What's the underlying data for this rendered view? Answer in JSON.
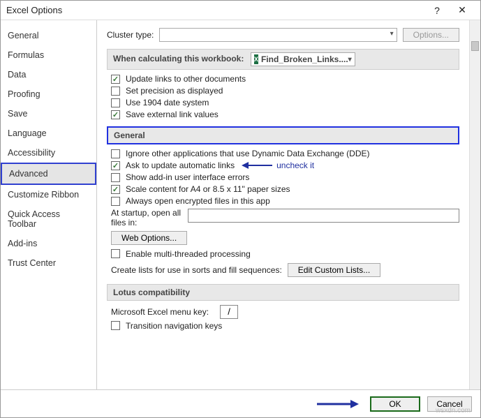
{
  "title": "Excel Options",
  "help_glyph": "?",
  "close_glyph": "✕",
  "sidebar": {
    "items": [
      {
        "label": "General"
      },
      {
        "label": "Formulas"
      },
      {
        "label": "Data"
      },
      {
        "label": "Proofing"
      },
      {
        "label": "Save"
      },
      {
        "label": "Language"
      },
      {
        "label": "Accessibility"
      },
      {
        "label": "Advanced"
      },
      {
        "label": "Customize Ribbon"
      },
      {
        "label": "Quick Access Toolbar"
      },
      {
        "label": "Add-ins"
      },
      {
        "label": "Trust Center"
      }
    ],
    "selected_index": 7
  },
  "cluster": {
    "label": "Cluster type:",
    "value": "",
    "options_btn": "Options..."
  },
  "calc_band": {
    "label": "When calculating this workbook:",
    "workbook": "Find_Broken_Links....",
    "items": [
      {
        "label": "Update links to other documents",
        "checked": true
      },
      {
        "label": "Set precision as displayed",
        "checked": false
      },
      {
        "label": "Use 1904 date system",
        "checked": false
      },
      {
        "label": "Save external link values",
        "checked": true
      }
    ]
  },
  "general_band": {
    "title": "General",
    "items": [
      {
        "label": "Ignore other applications that use Dynamic Data Exchange (DDE)",
        "checked": false
      },
      {
        "label": "Ask to update automatic links",
        "checked": true
      },
      {
        "label": "Show add-in user interface errors",
        "checked": false
      },
      {
        "label": "Scale content for A4 or 8.5 x 11\" paper sizes",
        "checked": true
      },
      {
        "label": "Always open encrypted files in this app",
        "checked": false
      }
    ],
    "annotation": "uncheck it",
    "startup_label": "At startup, open all files in:",
    "startup_value": "",
    "web_options": "Web Options...",
    "multithread": {
      "label": "Enable multi-threaded processing",
      "checked": false
    },
    "create_lists_label": "Create lists for use in sorts and fill sequences:",
    "edit_lists_btn": "Edit Custom Lists..."
  },
  "lotus_band": {
    "title": "Lotus compatibility",
    "menu_key_label": "Microsoft Excel menu key:",
    "menu_key_value": "/",
    "transition": {
      "label": "Transition navigation keys",
      "checked": false
    }
  },
  "footer": {
    "ok": "OK",
    "cancel": "Cancel"
  },
  "watermark": "wsxdn.com"
}
